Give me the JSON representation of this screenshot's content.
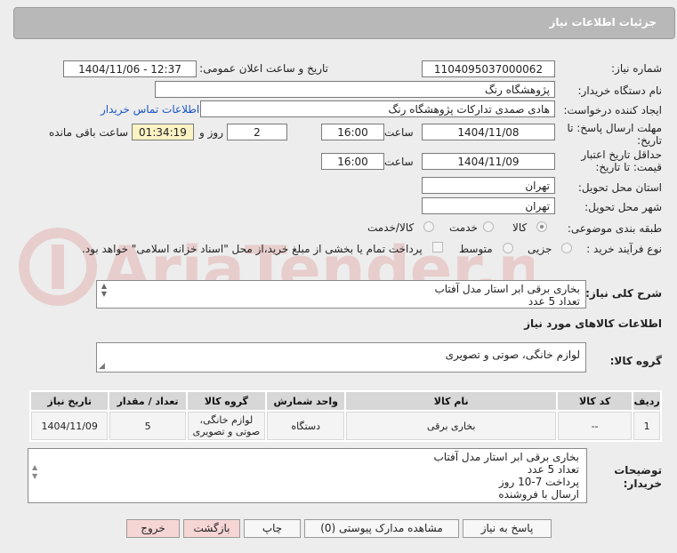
{
  "header": {
    "title": "جزئیات اطلاعات نیاز"
  },
  "fields": {
    "need_number_label": "شماره نیاز:",
    "need_number": "1104095037000062",
    "announce_label": "تاریخ و ساعت اعلان عمومی:",
    "announce_value": "1404/11/06 - 12:37",
    "buyer_label": "نام دستگاه خریدار:",
    "buyer_value": "پژوهشگاه رنگ",
    "creator_label": "ایجاد کننده درخواست:",
    "creator_value": "هادی صمدی تدارکات پژوهشگاه رنگ",
    "contact_link": "اطلاعات تماس خریدار",
    "deadline_label_1": "مهلت ارسال پاسخ: تا",
    "deadline_label_2": "تاریخ:",
    "deadline_date": "1404/11/08",
    "time_label": "ساعت",
    "deadline_time": "16:00",
    "days_value": "2",
    "days_label": "روز و",
    "remaining_value": "01:34:19",
    "remaining_label": "ساعت باقی مانده",
    "validity_label_1": "حداقل تاریخ اعتبار",
    "validity_label_2": "قیمت: تا تاریخ:",
    "validity_date": "1404/11/09",
    "validity_time_label": "ساعت",
    "validity_time": "16:00",
    "province_label": "استان محل تحویل:",
    "province_value": "تهران",
    "city_label": "شهر محل تحویل:",
    "city_value": "تهران",
    "category_label": "طبقه بندی موضوعی:",
    "category_options": [
      "کالا",
      "خدمت",
      "کالا/خدمت"
    ],
    "process_label": "نوع فرآیند خرید :",
    "process_options": [
      "جزیی",
      "متوسط"
    ],
    "payment_note": "پرداخت تمام یا بخشی از مبلغ خرید،از محل \"اسناد خزانه اسلامی\" خواهد بود."
  },
  "summary": {
    "label": "شرح کلی نیاز:",
    "lines": [
      "بخاری برقی ابر استار مدل آفتاب",
      "تعداد 5 عدد"
    ]
  },
  "goods_info_title": "اطلاعات کالاهای مورد نیاز",
  "goods_group": {
    "label": "گروه کالا:",
    "value": "لوازم خانگی، صوتی و تصویری"
  },
  "table": {
    "headers": [
      "ردیف",
      "کد کالا",
      "نام کالا",
      "واحد شمارش",
      "گروه کالا",
      "تعداد / مقدار",
      "تاریخ نیاز"
    ],
    "rows": [
      [
        "1",
        "--",
        "بخاری برقی",
        "دستگاه",
        "لوازم خانگی، صوتی و تصویری",
        "5",
        "1404/11/09"
      ]
    ]
  },
  "buyer_notes": {
    "label_1": "توضیحات",
    "label_2": "خریدار:",
    "lines": [
      "بخاری برقی ابر استار مدل آفتاب",
      "تعداد 5 عدد",
      "پرداخت 7-10 روز",
      "ارسال با فروشنده"
    ]
  },
  "buttons": {
    "reply": "پاسخ به نیاز",
    "attachments": "مشاهده مدارک پیوستی (0)",
    "print": "چاپ",
    "back": "بازگشت",
    "exit": "خروج"
  },
  "watermark": "AriaTender.net"
}
